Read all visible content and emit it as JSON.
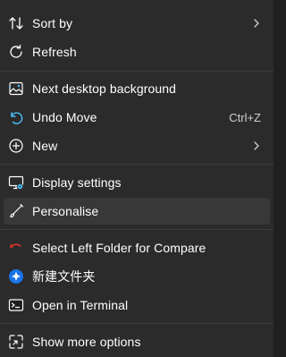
{
  "menu": {
    "items": [
      {
        "label": "Sort by",
        "icon": "sort-icon",
        "submenu": true
      },
      {
        "label": "Refresh",
        "icon": "refresh-icon"
      },
      {
        "label": "Next desktop background",
        "icon": "desktop-background-icon"
      },
      {
        "label": "Undo Move",
        "icon": "undo-icon",
        "shortcut": "Ctrl+Z"
      },
      {
        "label": "New",
        "icon": "plus-circle-icon",
        "submenu": true
      },
      {
        "label": "Display settings",
        "icon": "display-settings-icon"
      },
      {
        "label": "Personalise",
        "icon": "brush-icon",
        "highlighted": true
      },
      {
        "label": "Select Left Folder for Compare",
        "icon": "compare-icon"
      },
      {
        "label": "新建文件夹",
        "icon": "new-folder-app-icon"
      },
      {
        "label": "Open in Terminal",
        "icon": "terminal-icon"
      },
      {
        "label": "Show more options",
        "icon": "show-more-options-icon"
      }
    ]
  },
  "colors": {
    "background": "#2b2b2b",
    "separator": "#3d3d3d",
    "hover": "#383838",
    "text": "#ffffff",
    "compare_icon": "#e0342b",
    "new_folder_icon": "#1a73e8"
  }
}
